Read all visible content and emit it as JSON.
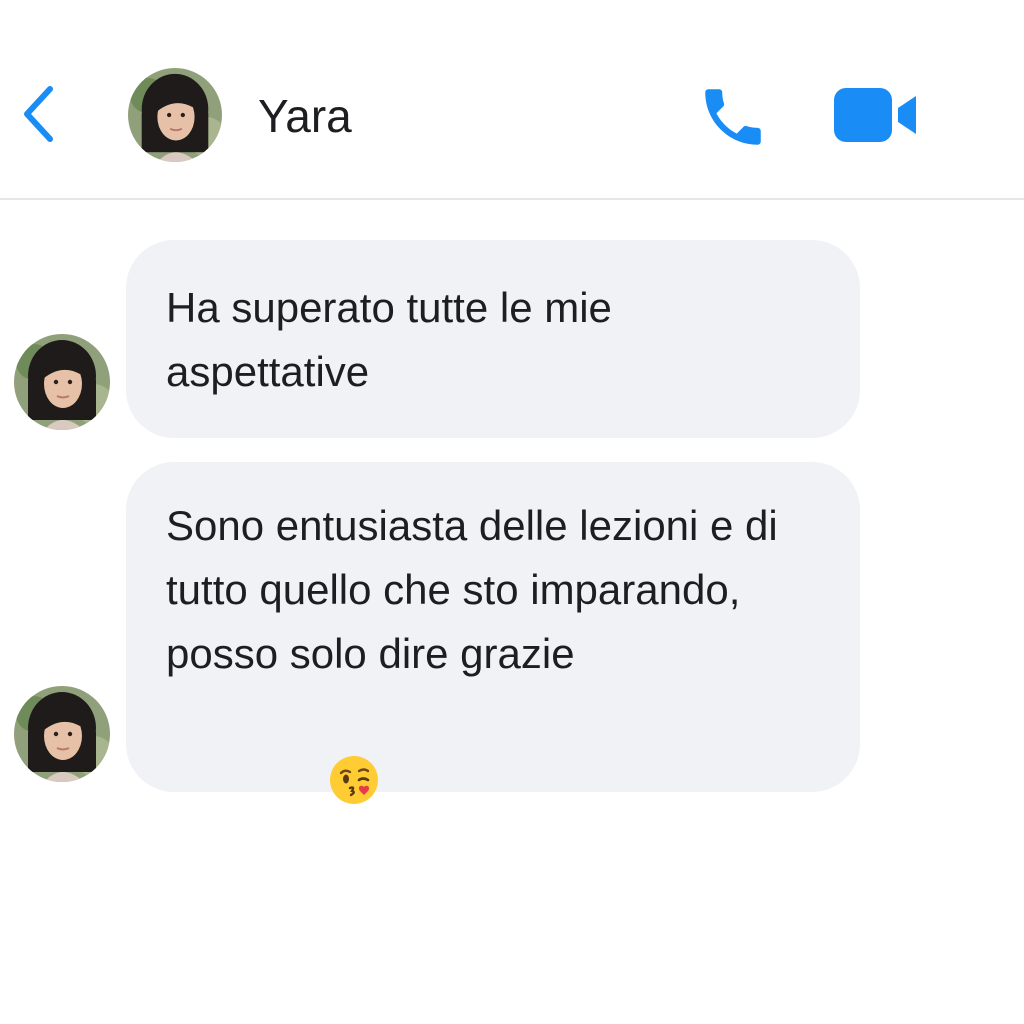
{
  "header": {
    "contact_name": "Yara",
    "back_icon": "chevron-left-icon",
    "call_icon": "phone-icon",
    "video_icon": "video-camera-icon",
    "accent_color": "#1a8cf5"
  },
  "messages": [
    {
      "sender": "Yara",
      "text": "Ha superato tutte le mie aspettative"
    },
    {
      "sender": "Yara",
      "text": "Sono entusiasta delle lezioni e di tutto quello che sto imparando, posso solo dire grazie",
      "reaction": "winking-kiss-emoji"
    }
  ],
  "colors": {
    "bubble_background": "#f0f2f6",
    "text": "#1c1e21",
    "divider": "#e4e6ea"
  }
}
